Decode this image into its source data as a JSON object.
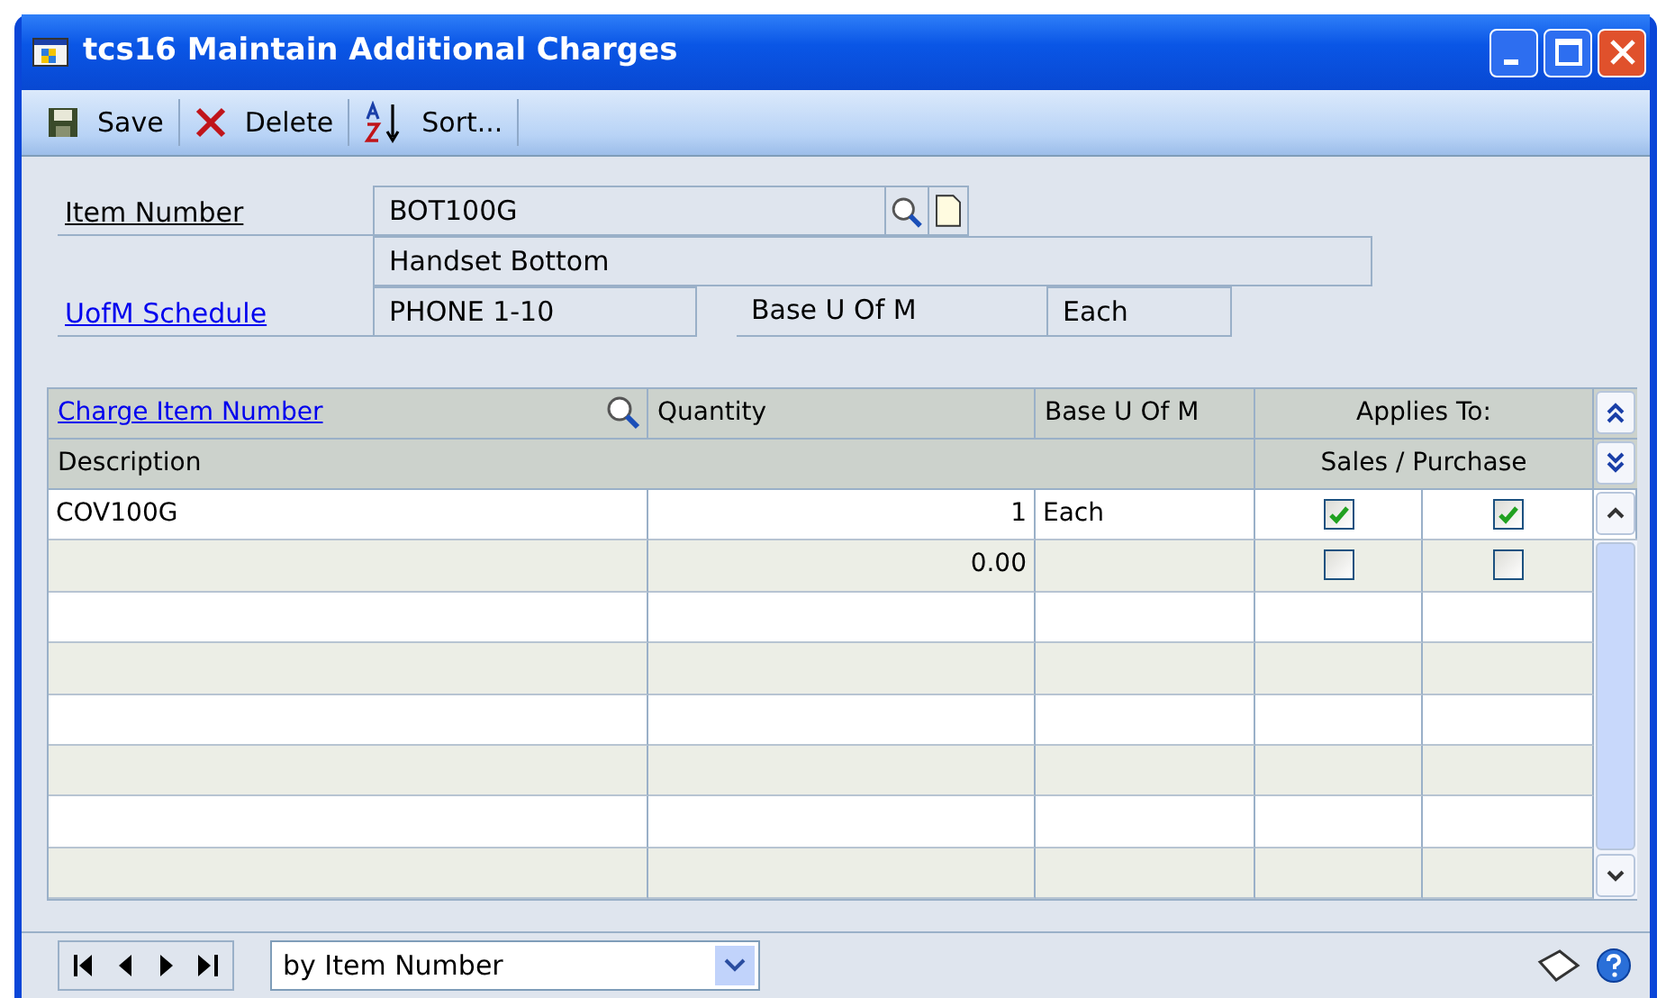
{
  "window": {
    "title": "tcs16 Maintain Additional Charges"
  },
  "toolbar": [
    {
      "kind": "save",
      "label": "Save"
    },
    {
      "kind": "delete",
      "label": "Delete"
    },
    {
      "kind": "sort",
      "label": "Sort..."
    }
  ],
  "form": {
    "item_number_label": "Item Number",
    "item_number": "BOT100G",
    "description": "Handset Bottom",
    "uofm_schedule_label": "UofM Schedule",
    "uofm_schedule": "PHONE 1-10",
    "base_uofm_label": "Base U Of M",
    "base_uofm": "Each"
  },
  "grid": {
    "columns": {
      "charge_item": "Charge Item Number",
      "quantity": "Quantity",
      "base_uofm": "Base U Of M",
      "applies_to": "Applies To:",
      "description": "Description",
      "sales_purchase": "Sales / Purchase"
    },
    "rows": [
      {
        "charge_item": "COV100G",
        "quantity": "1",
        "base_uofm": "Each",
        "sales": true,
        "purchase": true
      },
      {
        "quantity": "0.00",
        "sales": false,
        "purchase": false
      }
    ]
  },
  "footer": {
    "sort_by": "by Item Number"
  }
}
